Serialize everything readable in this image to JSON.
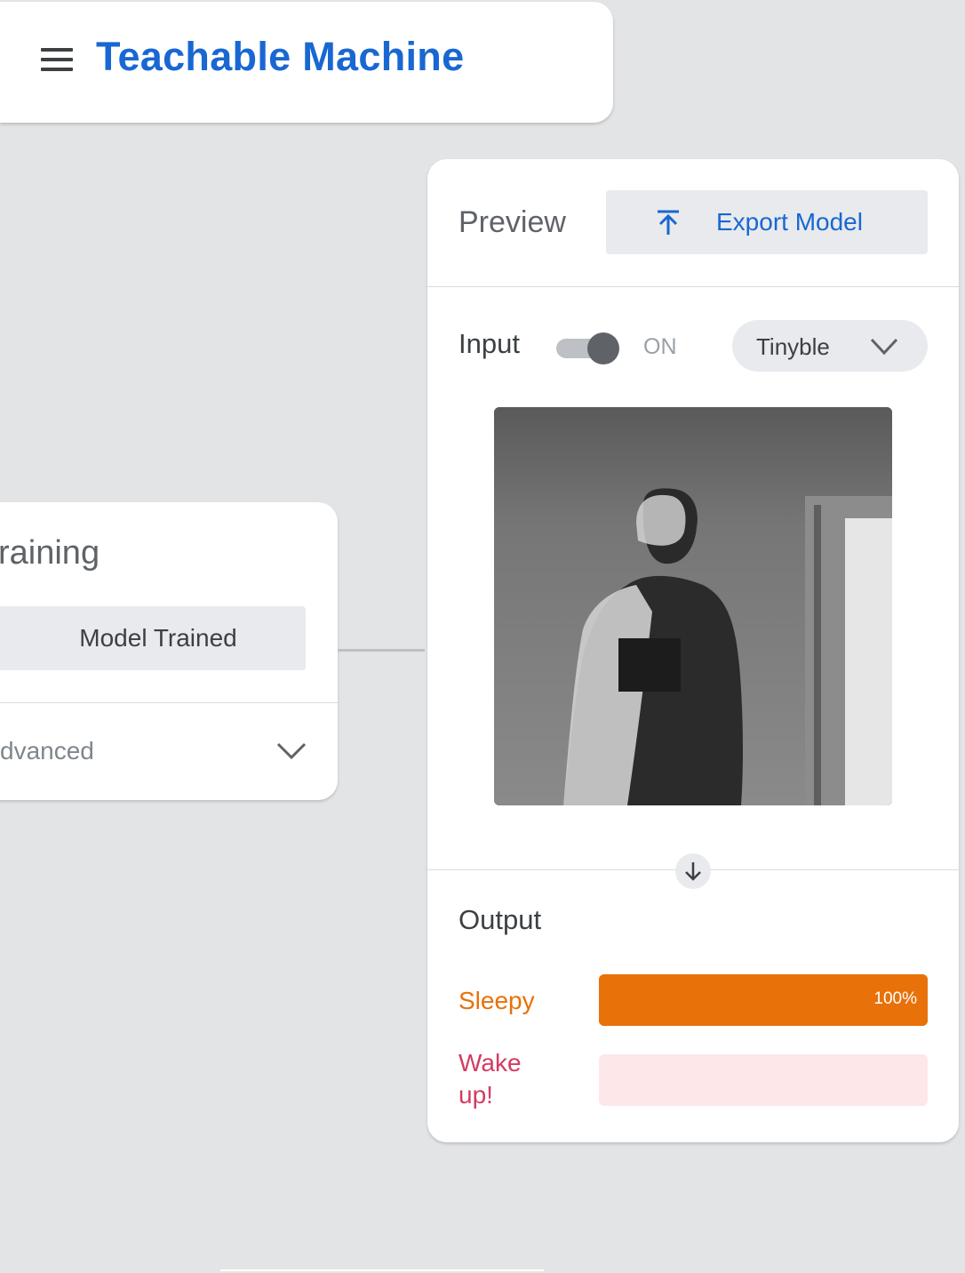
{
  "header": {
    "title": "Teachable Machine",
    "menu_icon": "hamburger-menu-icon"
  },
  "training": {
    "title": "raining",
    "status_button": "Model Trained",
    "advanced_label": "dvanced",
    "advanced_icon": "chevron-down-icon"
  },
  "preview": {
    "title": "Preview",
    "export_label": "Export Model",
    "export_icon": "upload-icon",
    "input_label": "Input",
    "toggle_state": "ON",
    "toggle_on": true,
    "device_selected": "Tinyble",
    "output_label": "Output",
    "classes": [
      {
        "label": "Sleepy",
        "confidence": 100,
        "display": "100%",
        "color": "#e8710a",
        "track": "#e8710a"
      },
      {
        "label": "Wake up!",
        "confidence": 0,
        "display": "",
        "color": "#d01884",
        "track": "#fde7e9"
      }
    ]
  },
  "colors": {
    "accent": "#1967d2",
    "background": "#e3e4e6",
    "sleepy": "#e8710a",
    "wake": "#c5221f"
  }
}
